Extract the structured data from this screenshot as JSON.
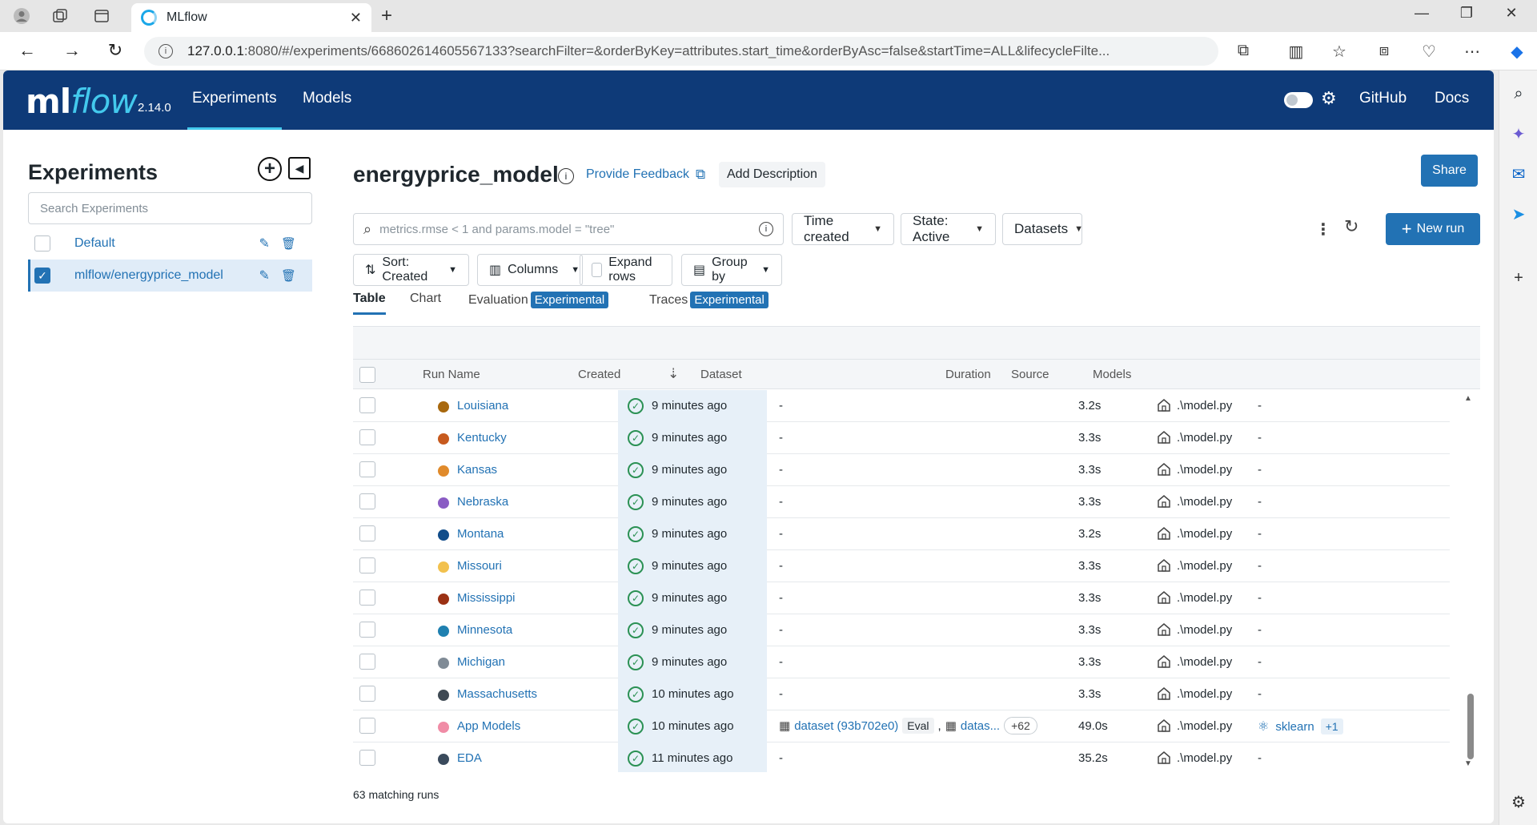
{
  "browser": {
    "tab_title": "MLflow",
    "url_host": "127.0.0.1",
    "url_rest": ":8080/#/experiments/668602614605567133?searchFilter=&orderByKey=attributes.start_time&orderByAsc=false&startTime=ALL&lifecycleFilte..."
  },
  "header": {
    "logo_ml": "ml",
    "logo_flow": "flow",
    "version": "2.14.0",
    "nav": [
      "Experiments",
      "Models"
    ],
    "links": [
      "GitHub",
      "Docs"
    ]
  },
  "sidebar": {
    "title": "Experiments",
    "search_placeholder": "Search Experiments",
    "items": [
      {
        "name": "Default",
        "selected": false
      },
      {
        "name": "mlflow/energyprice_model",
        "selected": true
      }
    ]
  },
  "main": {
    "experiment_name": "energyprice_model",
    "feedback": "Provide Feedback",
    "add_description": "Add Description",
    "share": "Share",
    "filter_placeholder": "metrics.rmse < 1 and params.model = \"tree\"",
    "time_created": "Time created",
    "state": "State: Active",
    "datasets": "Datasets",
    "new_run": "New run",
    "sort": "Sort: Created",
    "columns": "Columns",
    "expand_rows": "Expand rows",
    "group_by": "Group by",
    "tabs": {
      "table": "Table",
      "chart": "Chart",
      "evaluation": "Evaluation",
      "traces": "Traces",
      "experimental": "Experimental"
    },
    "columns_headers": {
      "run_name": "Run Name",
      "created": "Created",
      "dataset": "Dataset",
      "duration": "Duration",
      "source": "Source",
      "models": "Models"
    },
    "rows": [
      {
        "name": "Louisiana",
        "color": "#a8680e",
        "created": "9 minutes ago",
        "dataset": "-",
        "duration": "3.2s",
        "source": ".\\model.py",
        "models": "-"
      },
      {
        "name": "Kentucky",
        "color": "#c75a1e",
        "created": "9 minutes ago",
        "dataset": "-",
        "duration": "3.3s",
        "source": ".\\model.py",
        "models": "-"
      },
      {
        "name": "Kansas",
        "color": "#e08a2b",
        "created": "9 minutes ago",
        "dataset": "-",
        "duration": "3.3s",
        "source": ".\\model.py",
        "models": "-"
      },
      {
        "name": "Nebraska",
        "color": "#8a5cc4",
        "created": "9 minutes ago",
        "dataset": "-",
        "duration": "3.3s",
        "source": ".\\model.py",
        "models": "-"
      },
      {
        "name": "Montana",
        "color": "#114d8a",
        "created": "9 minutes ago",
        "dataset": "-",
        "duration": "3.2s",
        "source": ".\\model.py",
        "models": "-"
      },
      {
        "name": "Missouri",
        "color": "#f2c14e",
        "created": "9 minutes ago",
        "dataset": "-",
        "duration": "3.3s",
        "source": ".\\model.py",
        "models": "-"
      },
      {
        "name": "Mississippi",
        "color": "#9b3114",
        "created": "9 minutes ago",
        "dataset": "-",
        "duration": "3.3s",
        "source": ".\\model.py",
        "models": "-"
      },
      {
        "name": "Minnesota",
        "color": "#1f80b0",
        "created": "9 minutes ago",
        "dataset": "-",
        "duration": "3.3s",
        "source": ".\\model.py",
        "models": "-"
      },
      {
        "name": "Michigan",
        "color": "#808b96",
        "created": "9 minutes ago",
        "dataset": "-",
        "duration": "3.3s",
        "source": ".\\model.py",
        "models": "-"
      },
      {
        "name": "Massachusetts",
        "color": "#3f4a54",
        "created": "10 minutes ago",
        "dataset": "-",
        "duration": "3.3s",
        "source": ".\\model.py",
        "models": "-"
      },
      {
        "name": "App Models",
        "color": "#f08ca6",
        "created": "10 minutes ago",
        "dataset": "-",
        "duration": "49.0s",
        "source": ".\\model.py",
        "models": "-",
        "dataset_detail": {
          "link": "dataset (93b702e0)",
          "tag": "Eval",
          "sep": ",",
          "link2": "datas...",
          "more": "+62"
        },
        "model_detail": {
          "name": "sklearn",
          "more": "+1"
        }
      },
      {
        "name": "EDA",
        "color": "#3a4a5c",
        "created": "11 minutes ago",
        "dataset": "-",
        "duration": "35.2s",
        "source": ".\\model.py",
        "models": "-"
      }
    ],
    "matching": "63 matching runs"
  }
}
